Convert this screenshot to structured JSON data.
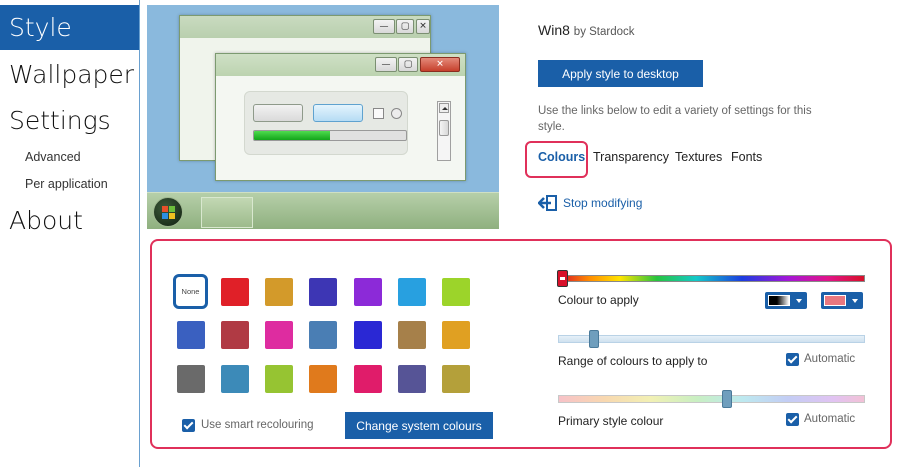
{
  "sidebar": {
    "items": [
      {
        "label": "Style"
      },
      {
        "label": "Wallpaper"
      },
      {
        "label": "Settings"
      },
      {
        "label": "Advanced"
      },
      {
        "label": "Per application"
      },
      {
        "label": "About"
      }
    ]
  },
  "style_info": {
    "name": "Win8",
    "author": "by Stardock",
    "apply_label": "Apply style to desktop",
    "description": "Use the links below to edit a variety of settings for this style."
  },
  "tabs": [
    {
      "label": "Colours"
    },
    {
      "label": "Transparency"
    },
    {
      "label": "Textures"
    },
    {
      "label": "Fonts"
    }
  ],
  "stop_modifying_label": "Stop modifying",
  "colours": {
    "none_label": "None",
    "swatches": [
      "#e02028",
      "#d39a2a",
      "#3d36b4",
      "#8c2ad8",
      "#28a0e0",
      "#9cd42a",
      "#3a60c0",
      "#b03a44",
      "#de2ca0",
      "#4a7eb4",
      "#2a28d4",
      "#a6804a",
      "#e0a022",
      "#6a6a6a",
      "#3c8ab8",
      "#96c432",
      "#e07a1c",
      "#e01c6a",
      "#565496",
      "#b4a03a"
    ],
    "smart_recolouring_label": "Use smart recolouring",
    "smart_recolouring_checked": true,
    "change_system_label": "Change system colours",
    "colour_to_apply_label": "Colour to apply",
    "range_label": "Range of colours to apply to",
    "range_automatic_label": "Automatic",
    "primary_label": "Primary style colour",
    "primary_automatic_label": "Automatic",
    "range_value": 0.11,
    "primary_value": 0.55,
    "hue_value": 0.0,
    "dropdown1_colors": [
      "#000000",
      "#ffffff"
    ],
    "dropdown2_color": "#e8777f"
  },
  "accent_color": "#1a5fa8",
  "highlight_color": "#e0305a"
}
